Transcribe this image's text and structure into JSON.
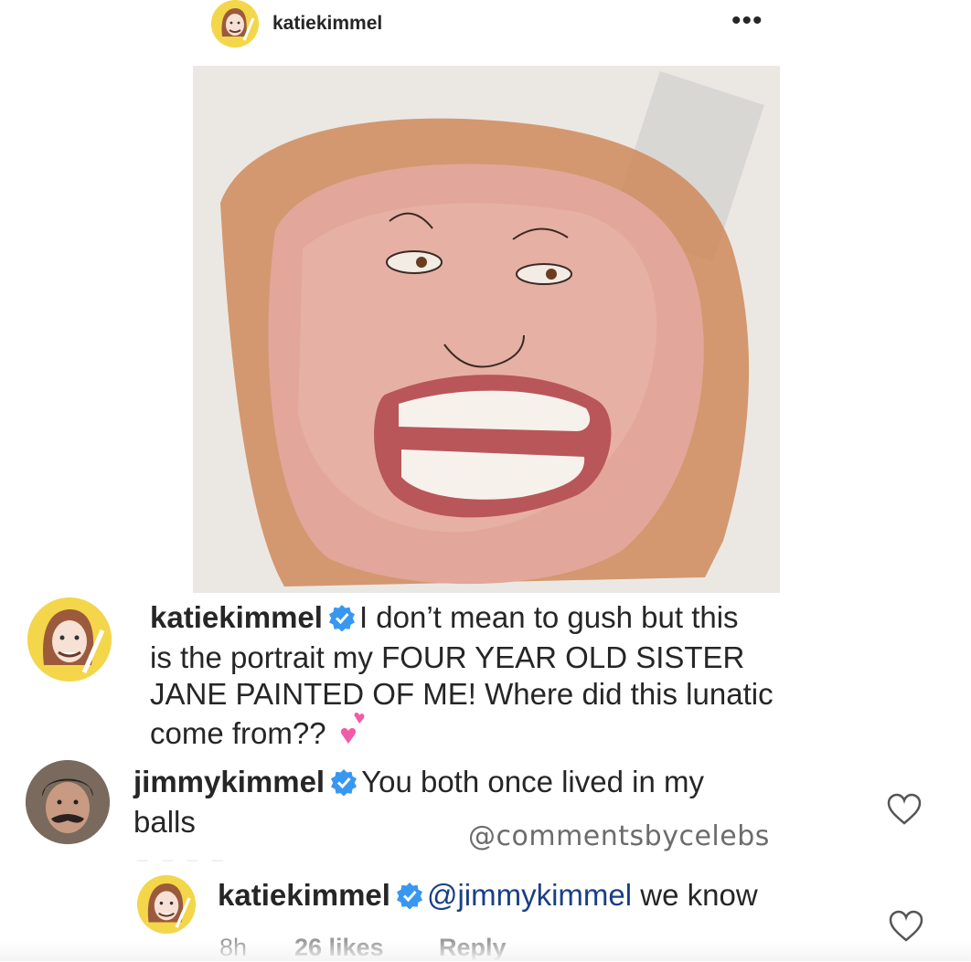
{
  "header": {
    "username": "katiekimmel",
    "more_icon": "more-options-icon",
    "more_glyph": "•••"
  },
  "post": {
    "image_icon": "watercolor-portrait-image"
  },
  "comments": [
    {
      "username": "katiekimmel",
      "verified": true,
      "lines": [
        "I don’t mean to gush but this",
        "is the portrait my FOUR YEAR OLD SISTER",
        "JANE PAINTED OF ME! Where did this lunatic",
        "come from??"
      ],
      "emoji": "two-hearts-emoji"
    },
    {
      "username": "jimmykimmel",
      "verified": true,
      "lines": [
        "You both once lived in my",
        "balls"
      ]
    }
  ],
  "watermark": "@commentsbycelebs",
  "reply": {
    "username": "katiekimmel",
    "verified": true,
    "mention": "@jimmykimmel",
    "text": "we know",
    "time": "8h",
    "likes": "26 likes",
    "reply_label": "Reply"
  },
  "colors": {
    "mention": "#1a3f85",
    "verified": "#3897f0",
    "meta": "#9a9a9a"
  }
}
